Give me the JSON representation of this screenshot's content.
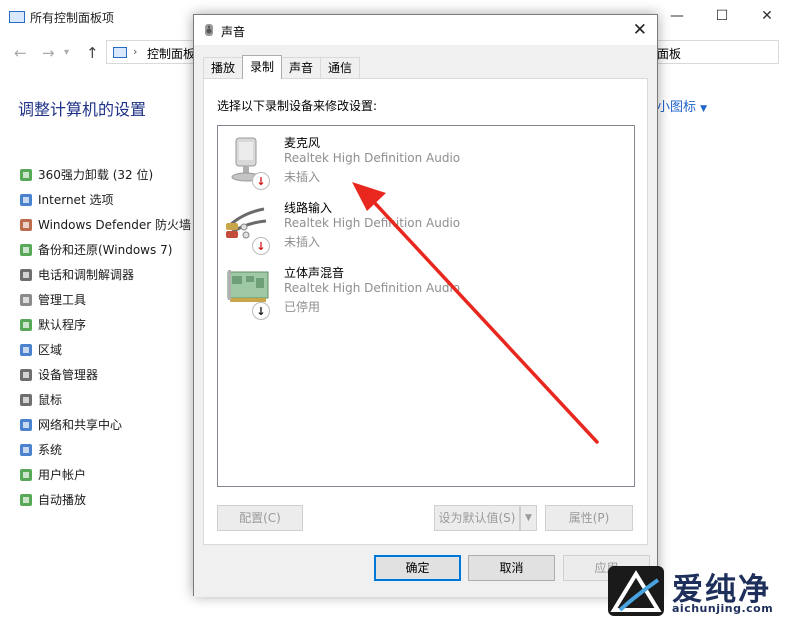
{
  "background_window": {
    "title": "所有控制面板项",
    "controls": {
      "minimize": "—",
      "maximize": "☐",
      "close": "✕"
    },
    "address": {
      "path_left": "控制面板",
      "path_right": "面板"
    },
    "heading": "调整计算机的设置",
    "view_by": "小图标",
    "items": [
      {
        "label": "360强力卸载 (32 位)",
        "icon": "uninstall-icon",
        "color": "#3a9a3a"
      },
      {
        "label": "Internet 选项",
        "icon": "internet-options-icon",
        "color": "#2a6cc4"
      },
      {
        "label": "Windows Defender 防火墙",
        "icon": "firewall-icon",
        "color": "#b0522e"
      },
      {
        "label": "备份和还原(Windows 7)",
        "icon": "backup-icon",
        "color": "#3a9a3a"
      },
      {
        "label": "电话和调制解调器",
        "icon": "phone-modem-icon",
        "color": "#555555"
      },
      {
        "label": "管理工具",
        "icon": "admin-tools-icon",
        "color": "#777777"
      },
      {
        "label": "默认程序",
        "icon": "default-programs-icon",
        "color": "#3a9a3a"
      },
      {
        "label": "区域",
        "icon": "region-icon",
        "color": "#2a6cc4"
      },
      {
        "label": "设备管理器",
        "icon": "device-manager-icon",
        "color": "#555555"
      },
      {
        "label": "鼠标",
        "icon": "mouse-icon",
        "color": "#555555"
      },
      {
        "label": "网络和共享中心",
        "icon": "network-icon",
        "color": "#2a6cc4"
      },
      {
        "label": "系统",
        "icon": "system-icon",
        "color": "#2a6cc4"
      },
      {
        "label": "用户帐户",
        "icon": "user-accounts-icon",
        "color": "#3a9a3a"
      },
      {
        "label": "自动播放",
        "icon": "autoplay-icon",
        "color": "#3a9a3a"
      }
    ]
  },
  "dialog": {
    "title": "声音",
    "close": "✕",
    "tabs": [
      {
        "label": "播放",
        "active": false
      },
      {
        "label": "录制",
        "active": true
      },
      {
        "label": "声音",
        "active": false
      },
      {
        "label": "通信",
        "active": false
      }
    ],
    "instruction": "选择以下录制设备来修改设置:",
    "devices": [
      {
        "name": "麦克风",
        "description": "Realtek High Definition Audio",
        "status": "未插入",
        "icon": "microphone-icon",
        "badge": "unplugged-badge-icon"
      },
      {
        "name": "线路输入",
        "description": "Realtek High Definition Audio",
        "status": "未插入",
        "icon": "line-in-icon",
        "badge": "unplugged-badge-icon"
      },
      {
        "name": "立体声混音",
        "description": "Realtek High Definition Audio",
        "status": "已停用",
        "icon": "stereo-mix-icon",
        "badge": "disabled-badge-icon"
      }
    ],
    "buttons": {
      "configure": "配置(C)",
      "set_default": "设为默认值(S)",
      "properties": "属性(P)",
      "ok": "确定",
      "cancel": "取消",
      "apply": "应用"
    }
  },
  "annotation": {
    "arrow_color": "#e8281e"
  },
  "watermark": {
    "text": "爱纯净",
    "url": "aichunjing.com"
  }
}
